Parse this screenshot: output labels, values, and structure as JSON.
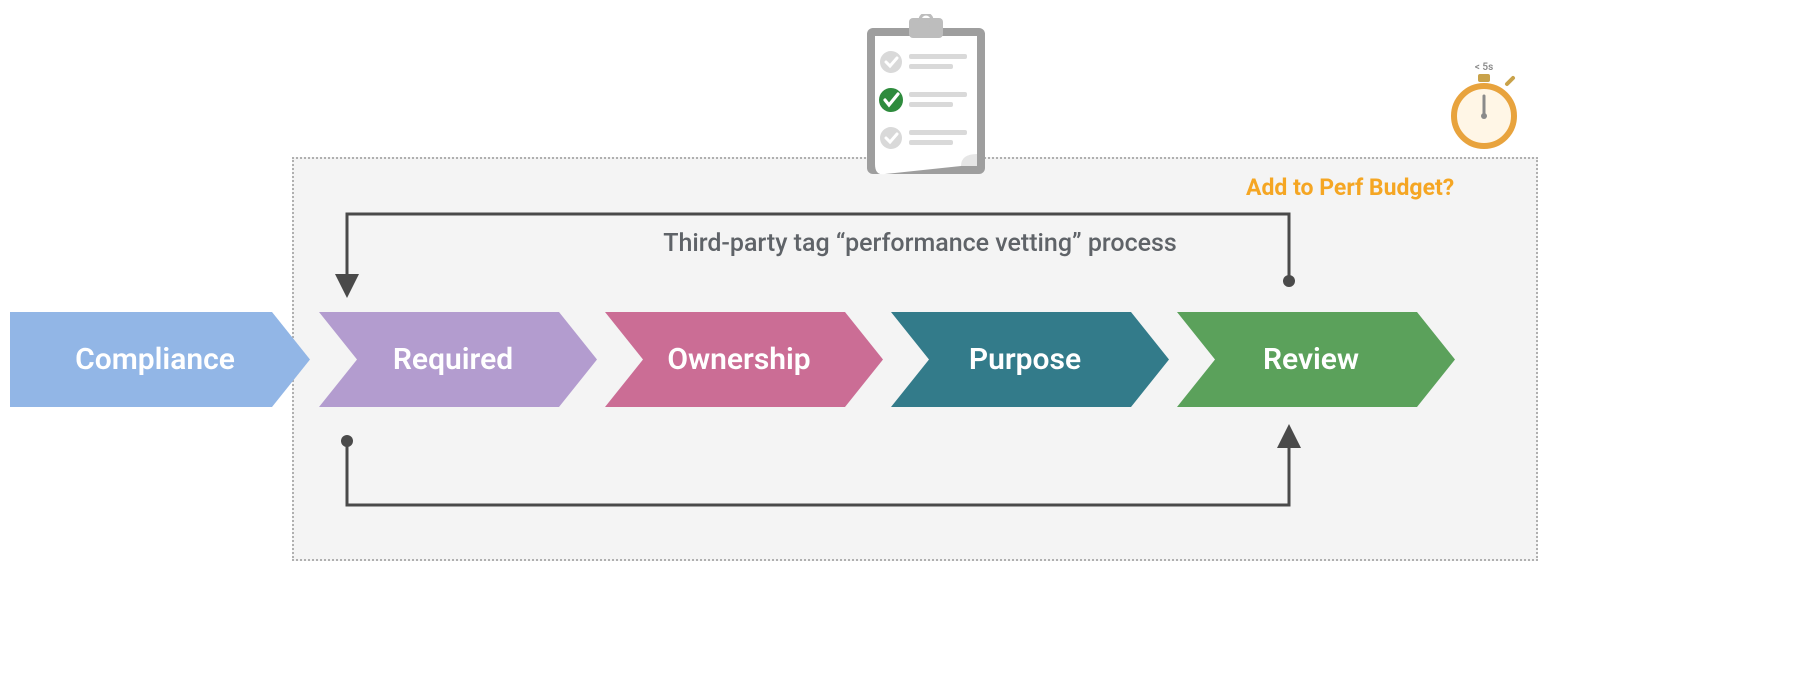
{
  "chart_data": {
    "type": "process-chevron",
    "title": "Third-party tag “performance vetting” process",
    "steps": [
      {
        "label": "Compliance",
        "color": "#92b6e6",
        "in_box": false
      },
      {
        "label": "Required",
        "color": "#b39ccf",
        "in_box": true
      },
      {
        "label": "Ownership",
        "color": "#cb6d95",
        "in_box": true
      },
      {
        "label": "Purpose",
        "color": "#337b8a",
        "in_box": true
      },
      {
        "label": "Review",
        "color": "#5ba15b",
        "in_box": true
      }
    ],
    "feedback_loops": [
      {
        "from": "Review",
        "to": "Required",
        "route": "above"
      },
      {
        "from": "Required",
        "to": "Review",
        "route": "below"
      }
    ],
    "callout": {
      "text": "Add to Perf Budget?",
      "color": "#f5a623",
      "icon": "stopwatch",
      "stopwatch_label": "< 5s"
    },
    "icon_top": "checklist-clipboard"
  },
  "caption": "Third-party tag “performance vetting” process",
  "perf_budget_label": "Add to Perf Budget?",
  "stopwatch_label": "< 5s",
  "steps": {
    "s0": "Compliance",
    "s1": "Required",
    "s2": "Ownership",
    "s3": "Purpose",
    "s4": "Review"
  }
}
